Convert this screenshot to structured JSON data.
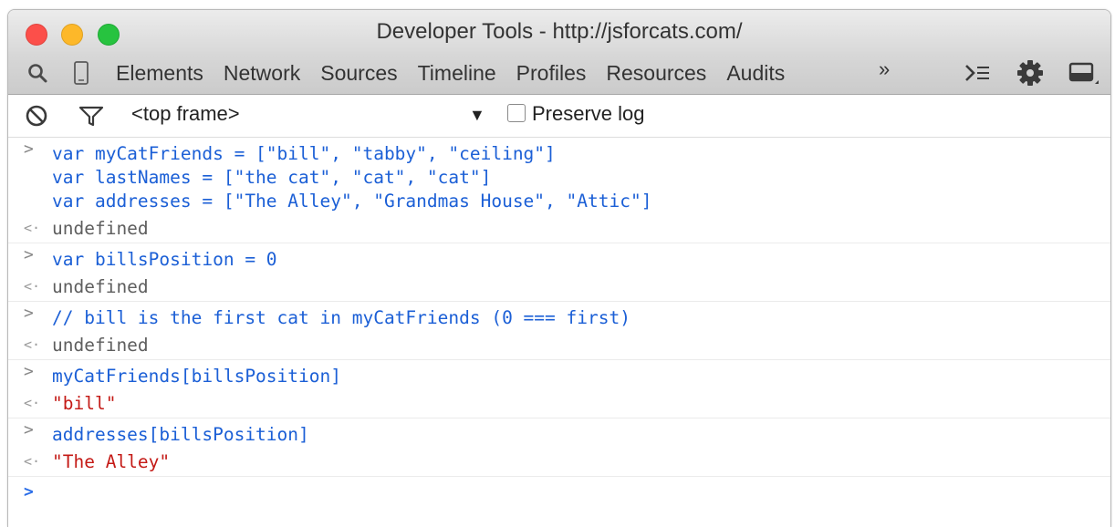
{
  "window": {
    "title": "Developer Tools - http://jsforcats.com/"
  },
  "toolbar": {
    "icons": {
      "search": "search-icon",
      "device": "device-mode-icon",
      "drawer": "console-drawer-icon",
      "settings": "gear-icon",
      "dock": "dock-icon"
    },
    "tabs": [
      "Elements",
      "Network",
      "Sources",
      "Timeline",
      "Profiles",
      "Resources",
      "Audits"
    ],
    "overflow": "»"
  },
  "filterbar": {
    "frame": "<top frame>",
    "preserve_log_label": "Preserve log",
    "preserve_log_checked": false
  },
  "console": {
    "entries": [
      {
        "input": [
          "var myCatFriends = [\"bill\", \"tabby\", \"ceiling\"]",
          "var lastNames = [\"the cat\", \"cat\", \"cat\"]",
          "var addresses = [\"The Alley\", \"Grandmas House\", \"Attic\"]"
        ],
        "output": "undefined"
      },
      {
        "input": [
          "var billsPosition = 0"
        ],
        "output": "undefined"
      },
      {
        "input": [
          "// bill is the first cat in myCatFriends (0 === first)"
        ],
        "output": "undefined"
      },
      {
        "input": [
          "myCatFriends[billsPosition]"
        ],
        "output": "\"bill\""
      },
      {
        "input": [
          "addresses[billsPosition]"
        ],
        "output": "\"The Alley\""
      }
    ],
    "prompt_symbol": ">",
    "result_symbol": "<·",
    "colors": {
      "input": "#1b5fd6",
      "undefined": "#5e5e5e",
      "string": "#c41a16"
    }
  }
}
